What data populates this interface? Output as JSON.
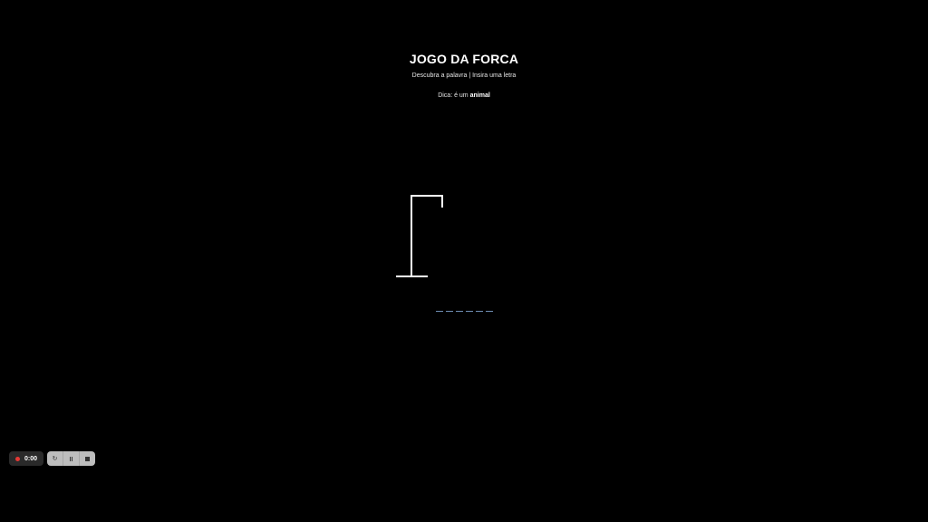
{
  "game": {
    "title": "JOGO DA FORCA",
    "subtitle": "Descubra a palavra | Insira uma letra",
    "hint_prefix": "Dica: é um",
    "hint_word": "animal",
    "word_slots": [
      "",
      "",
      "",
      "",
      "",
      ""
    ],
    "colors": {
      "background": "#000000",
      "text": "#ffffff",
      "slot_line": "#6f8fb3"
    }
  },
  "recorder": {
    "timer": "0:00",
    "icons": [
      "record-dot-icon",
      "restart-icon",
      "pause-icon",
      "stop-icon"
    ],
    "restart_glyph": "↻"
  }
}
